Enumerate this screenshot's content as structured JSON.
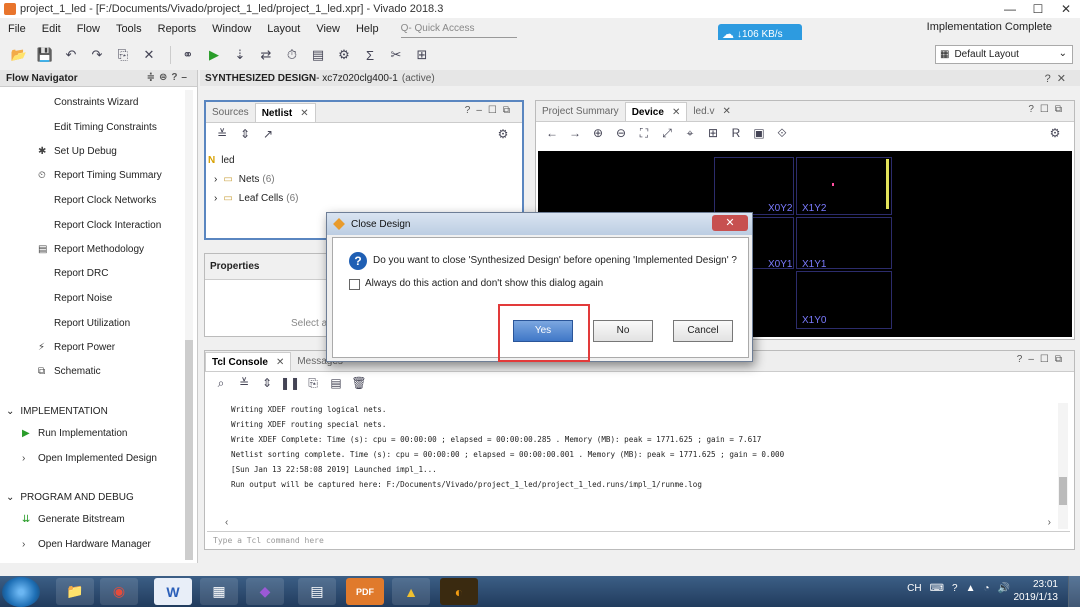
{
  "window": {
    "title": "project_1_led - [F:/Documents/Vivado/project_1_led/project_1_led.xpr] - Vivado 2018.3",
    "controls": [
      "—",
      "☐",
      "✕"
    ]
  },
  "menubar": {
    "items": [
      "File",
      "Edit",
      "Flow",
      "Tools",
      "Reports",
      "Window",
      "Layout",
      "View",
      "Help"
    ],
    "quick_access_placeholder": "Q- Quick Access",
    "status": "Implementation Complete"
  },
  "net_speed": "↓106 KB/s",
  "layout_select": {
    "value": "Default Layout"
  },
  "flow_navigator": {
    "title": "Flow Navigator",
    "items": [
      {
        "label": "Constraints Wizard",
        "icon": ""
      },
      {
        "label": "Edit Timing Constraints",
        "icon": ""
      },
      {
        "label": "Set Up Debug",
        "icon": "bug-icon"
      },
      {
        "label": "Report Timing Summary",
        "icon": "clock-icon"
      },
      {
        "label": "Report Clock Networks",
        "icon": ""
      },
      {
        "label": "Report Clock Interaction",
        "icon": ""
      },
      {
        "label": "Report Methodology",
        "icon": "report-icon"
      },
      {
        "label": "Report DRC",
        "icon": ""
      },
      {
        "label": "Report Noise",
        "icon": ""
      },
      {
        "label": "Report Utilization",
        "icon": ""
      },
      {
        "label": "Report Power",
        "icon": "power-icon"
      },
      {
        "label": "Schematic",
        "icon": "schematic-icon"
      }
    ],
    "sections": [
      {
        "label": "IMPLEMENTATION",
        "children": [
          "Run Implementation",
          "Open Implemented Design"
        ]
      },
      {
        "label": "PROGRAM AND DEBUG",
        "children": [
          "Generate Bitstream",
          "Open Hardware Manager"
        ]
      }
    ]
  },
  "main_header": {
    "title": "SYNTHESIZED DESIGN",
    "part": " - xc7z020clg400-1",
    "state": "(active)"
  },
  "sources_panel": {
    "tabs": [
      "Sources",
      "Netlist"
    ],
    "root": "led",
    "rows": [
      {
        "label": "Nets",
        "count": "(6)"
      },
      {
        "label": "Leaf Cells",
        "count": "(6)"
      }
    ]
  },
  "properties_panel": {
    "title": "Properties",
    "hint": "Select a"
  },
  "device_panel": {
    "tabs": [
      "Project Summary",
      "Device",
      "led.v"
    ],
    "clock_regions": [
      "X0Y2",
      "X1Y2",
      "X0Y1",
      "X1Y1",
      "X1Y0"
    ]
  },
  "console_panel": {
    "tabs": [
      "Tcl Console",
      "Messages"
    ],
    "log": [
      "Writing XDEF routing logical nets.",
      "Writing XDEF routing special nets.",
      "Write XDEF Complete: Time (s): cpu = 00:00:00 ; elapsed = 00:00:00.285 . Memory (MB): peak = 1771.625 ; gain = 7.617",
      "Netlist sorting complete. Time (s): cpu = 00:00:00 ; elapsed = 00:00:00.001 . Memory (MB): peak = 1771.625 ; gain = 0.000",
      "[Sun Jan 13 22:58:08 2019] Launched impl_1...",
      "Run output will be captured here: F:/Documents/Vivado/project_1_led/project_1_led.runs/impl_1/runme.log"
    ],
    "input_placeholder": "Type a Tcl command here"
  },
  "dialog": {
    "title": "Close Design",
    "question": "Do you want to close 'Synthesized Design' before opening 'Implemented Design' ?",
    "checkbox_label": "Always do this action and don't show this dialog again",
    "yes": "Yes",
    "no": "No",
    "cancel": "Cancel"
  },
  "taskbar": {
    "apps": [
      "📁",
      "◉",
      "W",
      "▦",
      "◆",
      "▤",
      "PDF",
      "▲",
      "◐"
    ],
    "tray": "CH",
    "time": "23:01",
    "date": "2019/1/13"
  },
  "colors": {
    "accent": "#2d9be0",
    "dialog_yes": "#3f77c7",
    "highlight": "#e23a3a"
  }
}
